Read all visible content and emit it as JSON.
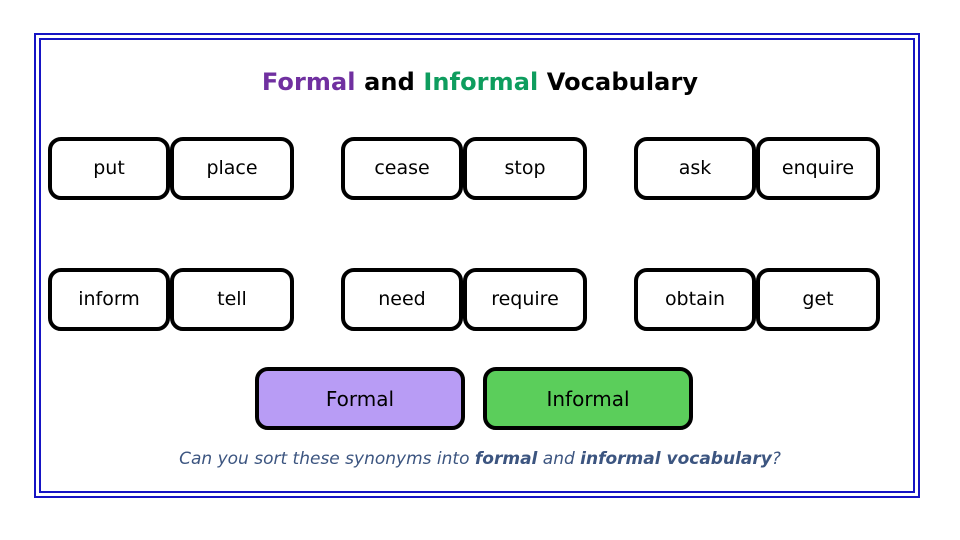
{
  "title": {
    "segment_formal": "Formal",
    "segment_and": " and ",
    "segment_informal": "Informal",
    "segment_vocabulary": " Vocabulary",
    "full": "Formal and Informal Vocabulary"
  },
  "colors": {
    "frame_blue": "#1614C4",
    "title_formal_purple": "#7030A0",
    "title_informal_green": "#0E9D5E",
    "formal_box_fill": "#B89CF5",
    "informal_box_fill": "#5BCE5B",
    "card_border": "#000000",
    "caption_text": "#3C5580"
  },
  "rows": [
    {
      "row_index": 1,
      "pairs": [
        {
          "formal_word": "put",
          "informal_word": "place"
        },
        {
          "formal_word": "cease",
          "informal_word": "stop"
        },
        {
          "formal_word": "ask",
          "informal_word": "enquire"
        }
      ]
    },
    {
      "row_index": 2,
      "pairs": [
        {
          "formal_word": "inform",
          "informal_word": "tell"
        },
        {
          "formal_word": "need",
          "informal_word": "require"
        },
        {
          "formal_word": "obtain",
          "informal_word": "get"
        }
      ]
    }
  ],
  "word_cards": [
    "put",
    "place",
    "cease",
    "stop",
    "ask",
    "enquire",
    "inform",
    "tell",
    "need",
    "require",
    "obtain",
    "get"
  ],
  "categories": {
    "formal_label": "Formal",
    "informal_label": "Informal"
  },
  "caption": {
    "part1": "Can you sort these synonyms into ",
    "strong1": "formal",
    "part2": " and ",
    "strong2": "informal vocabulary",
    "part3": "?",
    "full": "Can you sort these synonyms into formal and informal vocabulary?"
  }
}
